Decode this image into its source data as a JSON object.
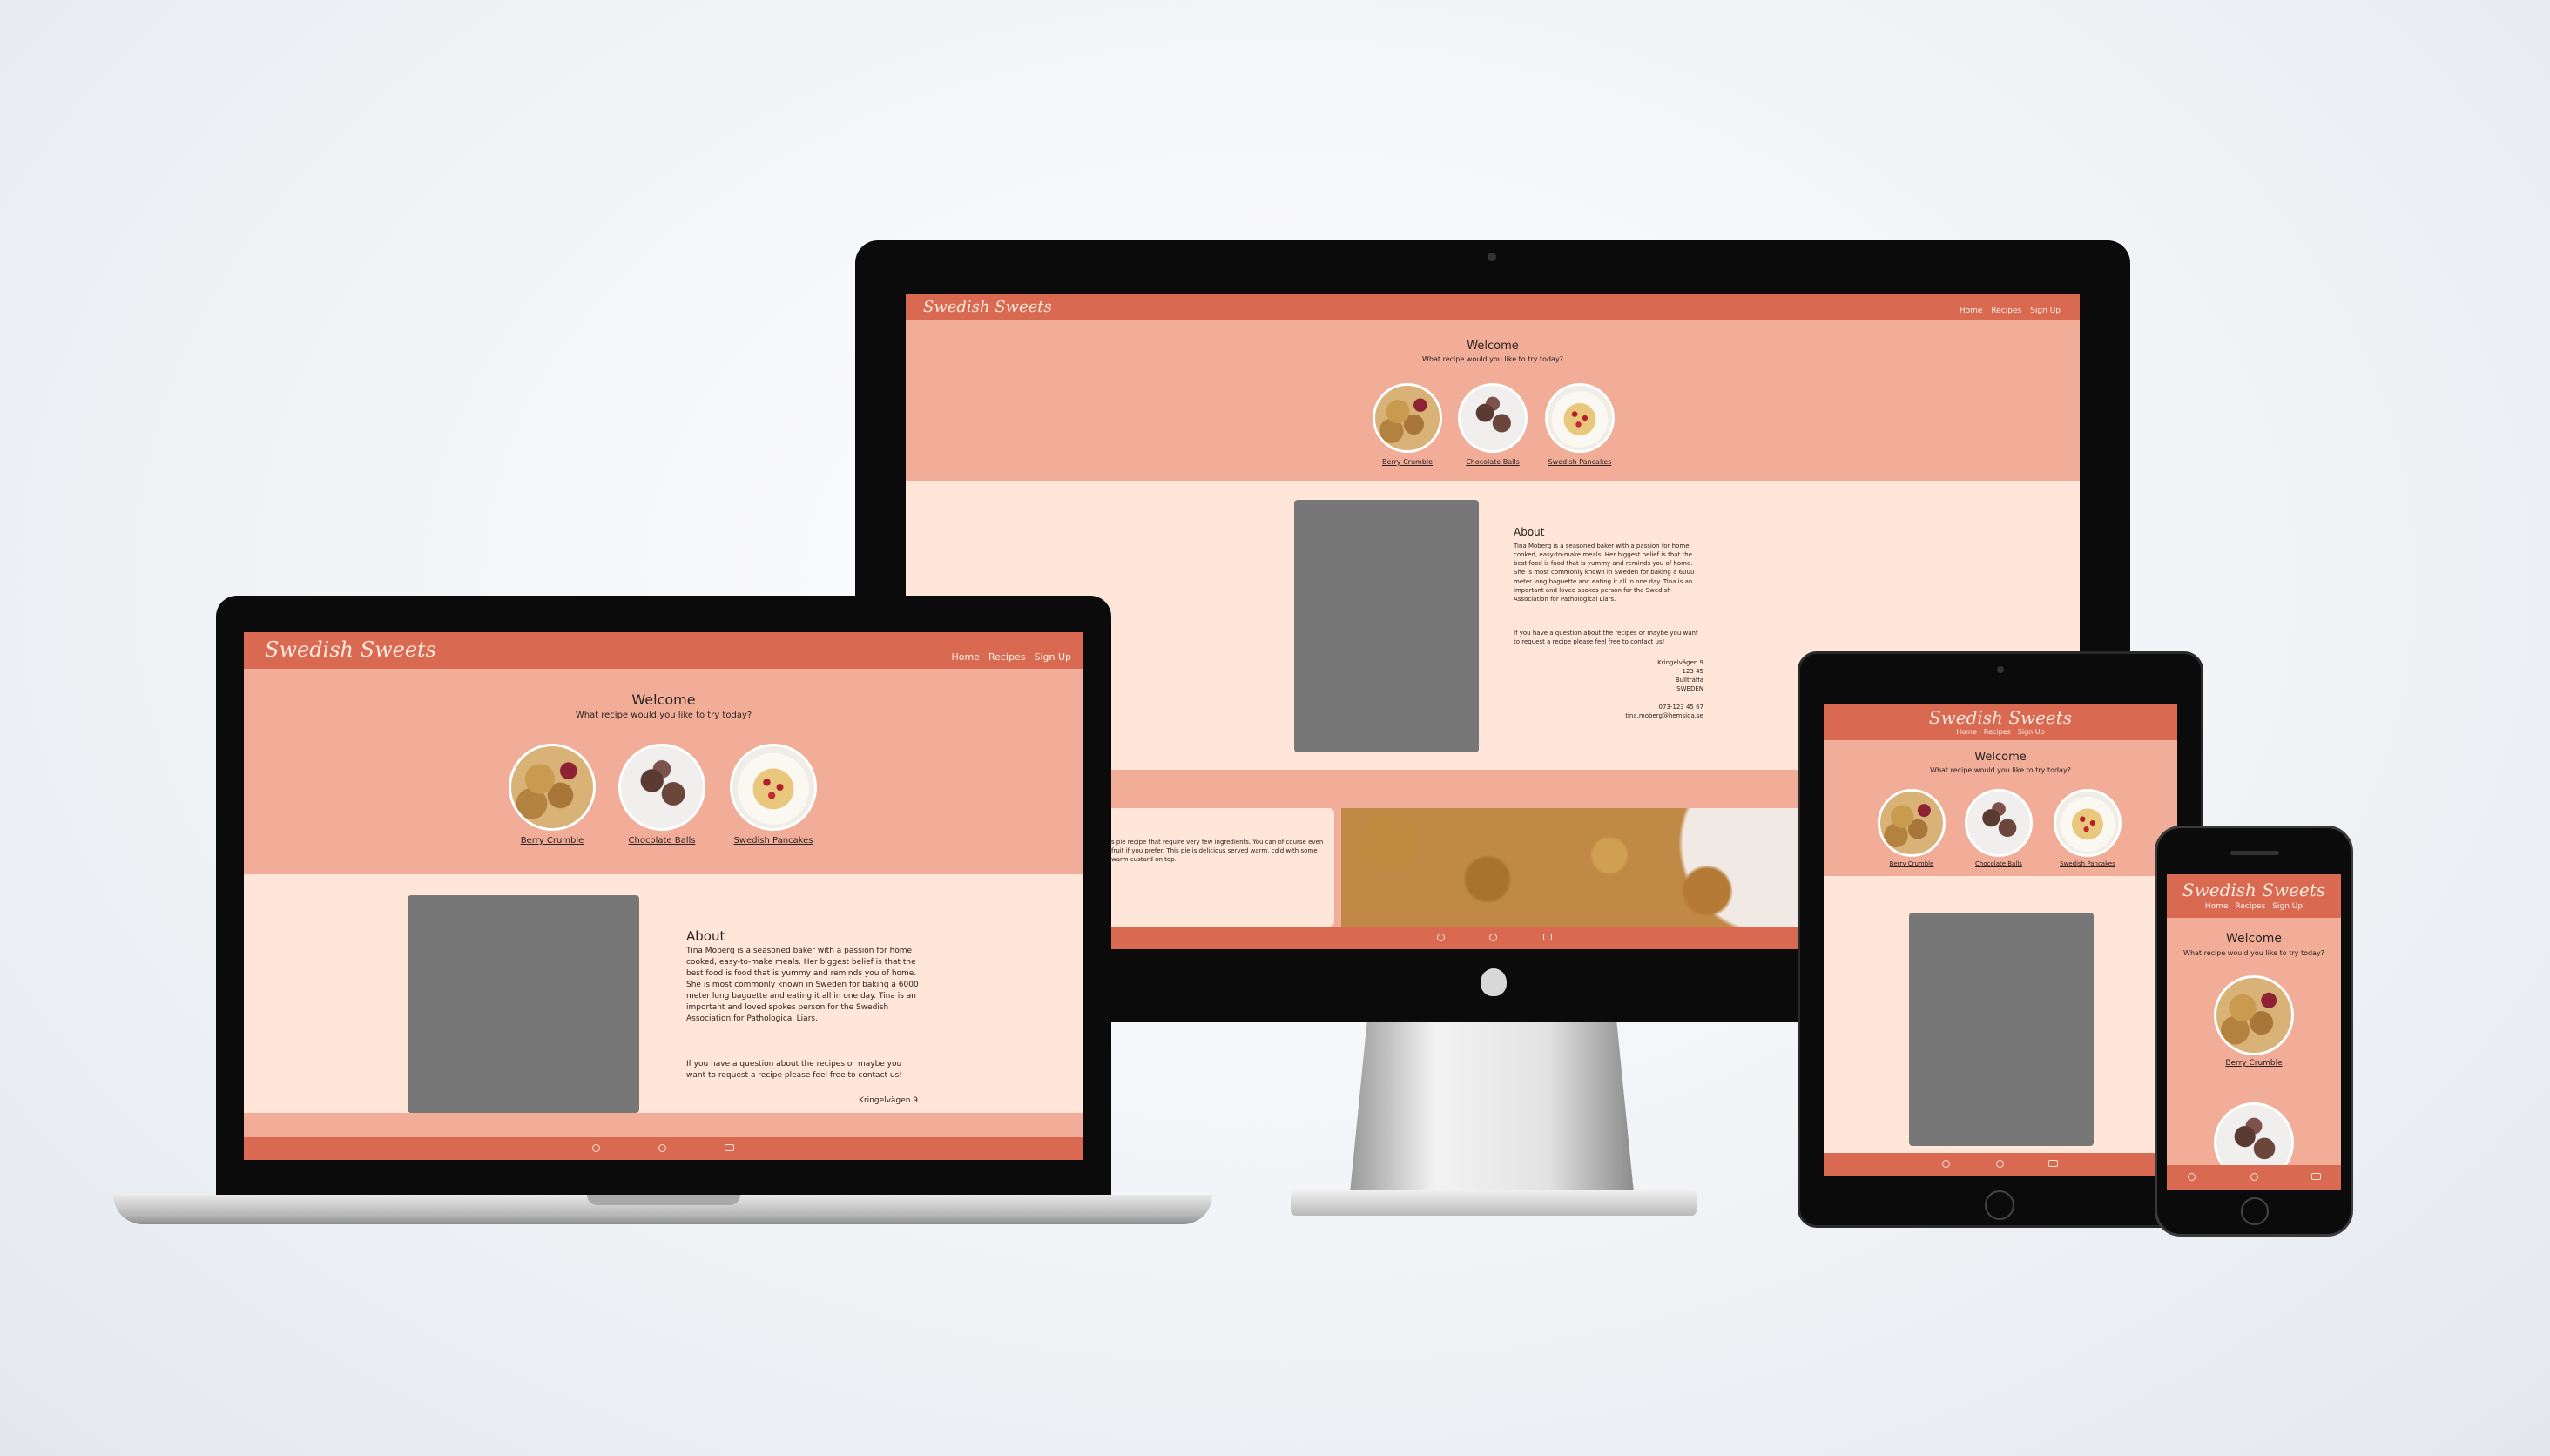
{
  "site": {
    "logo": "Swedish Sweets",
    "nav": [
      "Home",
      "Recipes",
      "Sign Up"
    ],
    "welcome": "Welcome",
    "subtitle": "What recipe would you like to try today?",
    "recipes": [
      "Berry Crumble",
      "Chocolate Balls",
      "Swedish Pancakes"
    ],
    "about_title": "About",
    "about_text": "Tina Moberg is a seasoned baker with a passion for home cooked, easy-to-make meals. Her biggest belief is that the best food is food that is yummy and reminds you of home. She is most commonly known in Sweden for baking a 6000 meter long baguette and eating it all in one day. Tina is an important and loved spokes person for the Swedish Association for Pathological Liars.",
    "contact_text": "If you have a question about the recipes or maybe you want to request a recipe please feel free to contact us!",
    "address": [
      "Kringelvägen 9",
      "123 45",
      "Bullträffa",
      "SWEDEN"
    ],
    "phone": "073-123 45 67",
    "email": "tina.moberg@hemsida.se",
    "crumble_text": "s pie recipe that require very few ingredients. You can of course even fruit if you prefer. This pie is delicious served warm, cold with some warm custard on top.",
    "footer_icons": [
      "instagram-icon",
      "pinterest-icon",
      "youtube-icon"
    ]
  },
  "colors": {
    "header": "#d96a51",
    "hero": "#f2ad98",
    "body": "#ffe6d9"
  }
}
